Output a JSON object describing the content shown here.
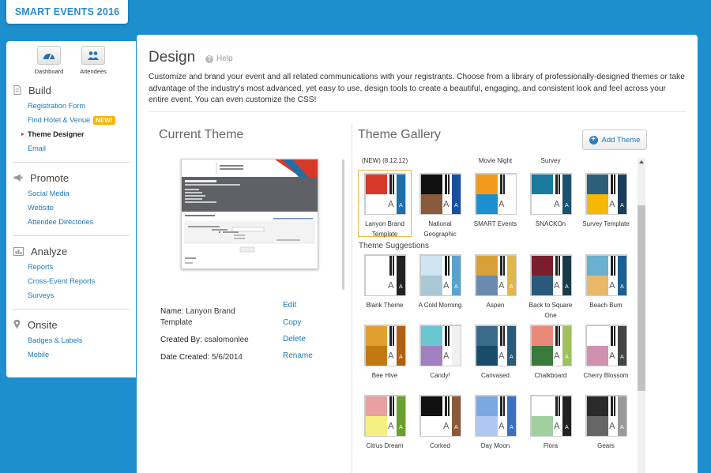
{
  "event": {
    "title": "SMART EVENTS 2016"
  },
  "quick": [
    {
      "label": "Dashboard",
      "icon": "gauge-icon"
    },
    {
      "label": "Attendees",
      "icon": "people-icon"
    }
  ],
  "nav": {
    "build": {
      "title": "Build",
      "icon": "document-icon",
      "links": [
        "Registration Form",
        "Find Hotel & Venue",
        "Theme Designer",
        "Email"
      ],
      "new_badge": "NEW!"
    },
    "promote": {
      "title": "Promote",
      "icon": "megaphone-icon",
      "links": [
        "Social Media",
        "Website",
        "Attendee Directories"
      ]
    },
    "analyze": {
      "title": "Analyze",
      "icon": "bar-chart-icon",
      "links": [
        "Reports",
        "Cross-Event Reports",
        "Surveys"
      ]
    },
    "onsite": {
      "title": "Onsite",
      "icon": "location-pin-icon",
      "links": [
        "Badges & Labels",
        "Mobile"
      ]
    }
  },
  "page": {
    "title": "Design",
    "help": "Help",
    "intro": "Customize and brand your event and all related communications with your registrants. Choose from a library of professionally-designed themes or take advantage of the industry's most advanced, yet easy to use, design tools to create a beautiful, engaging, and consistent look and feel across your entire event. You can even customize the CSS!"
  },
  "current": {
    "title": "Current Theme",
    "preview_brand": "Lanyon",
    "name_label": "Name:",
    "name_value": "Lanyon Brand Template",
    "created_by_label": "Created By:",
    "created_by_value": "csalomonlee",
    "date_label": "Date Created:",
    "date_value": "5/6/2014",
    "actions": [
      "Edit",
      "Copy",
      "Delete",
      "Rename"
    ]
  },
  "gallery": {
    "title": "Theme Gallery",
    "add_theme": "Add Theme",
    "suggestions_label": "Theme Suggestions",
    "my_themes": [
      {
        "top": "(NEW) (8.12.12)",
        "name": "Lanyon Brand Template",
        "colors": [
          "#d6392a",
          "#ffffff",
          "#1f6fa8"
        ]
      },
      {
        "top": "",
        "name": "National Geographic",
        "colors": [
          "#111111",
          "#8a5a3a",
          "#1a4fa0"
        ]
      },
      {
        "top": "Movie Night",
        "name": "SMART Events",
        "colors": [
          "#f39a1a",
          "#1d8fce",
          "#ffffff"
        ]
      },
      {
        "top": "Survey",
        "name": "SNACKOn",
        "colors": [
          "#1a7aa0",
          "#ffffff",
          "#1a5070"
        ]
      },
      {
        "top": "",
        "name": "Survey Template",
        "colors": [
          "#2c5f7a",
          "#f6b800",
          "#1a3e5a"
        ]
      }
    ],
    "suggestions": [
      {
        "name": "Blank Theme",
        "colors": [
          "#ffffff",
          "#ffffff",
          "#222222"
        ]
      },
      {
        "name": "A Cold Morning",
        "colors": [
          "#cfe6f2",
          "#aac8d8",
          "#5aa3cf"
        ]
      },
      {
        "name": "Aspen",
        "colors": [
          "#d7a13a",
          "#6a8ab0",
          "#e0b84a"
        ]
      },
      {
        "name": "Back to Square One",
        "colors": [
          "#7a1e2e",
          "#2a5a7a",
          "#1a3a4a"
        ]
      },
      {
        "name": "Beach Bum",
        "colors": [
          "#6ab0cf",
          "#e8b86a",
          "#1a6090"
        ]
      },
      {
        "name": "Bee Hive",
        "colors": [
          "#e0a030",
          "#c07a10",
          "#b06010"
        ]
      },
      {
        "name": "Candy!",
        "colors": [
          "#6ac6cf",
          "#a080c0",
          "#f0f0f0"
        ]
      },
      {
        "name": "Canvased",
        "colors": [
          "#3a6a8a",
          "#1a4a6a",
          "#2a5a7a"
        ]
      },
      {
        "name": "Chalkboard",
        "colors": [
          "#e88a7a",
          "#3a7a3a",
          "#a0c060"
        ]
      },
      {
        "name": "Cherry Blossom",
        "colors": [
          "#ffffff",
          "#d090b0",
          "#444444"
        ]
      },
      {
        "name": "Citrus Dream",
        "colors": [
          "#e8a0a0",
          "#f6f080",
          "#6aa030"
        ]
      },
      {
        "name": "Corked",
        "colors": [
          "#111111",
          "#ffffff",
          "#8a5a3a"
        ]
      },
      {
        "name": "Day Moon",
        "colors": [
          "#7aa8e0",
          "#b0c8f0",
          "#3a70c0"
        ]
      },
      {
        "name": "Flora",
        "colors": [
          "#ffffff",
          "#a0d0a0",
          "#222222"
        ]
      },
      {
        "name": "Gears",
        "colors": [
          "#2a2a2a",
          "#666666",
          "#999999"
        ]
      }
    ]
  }
}
